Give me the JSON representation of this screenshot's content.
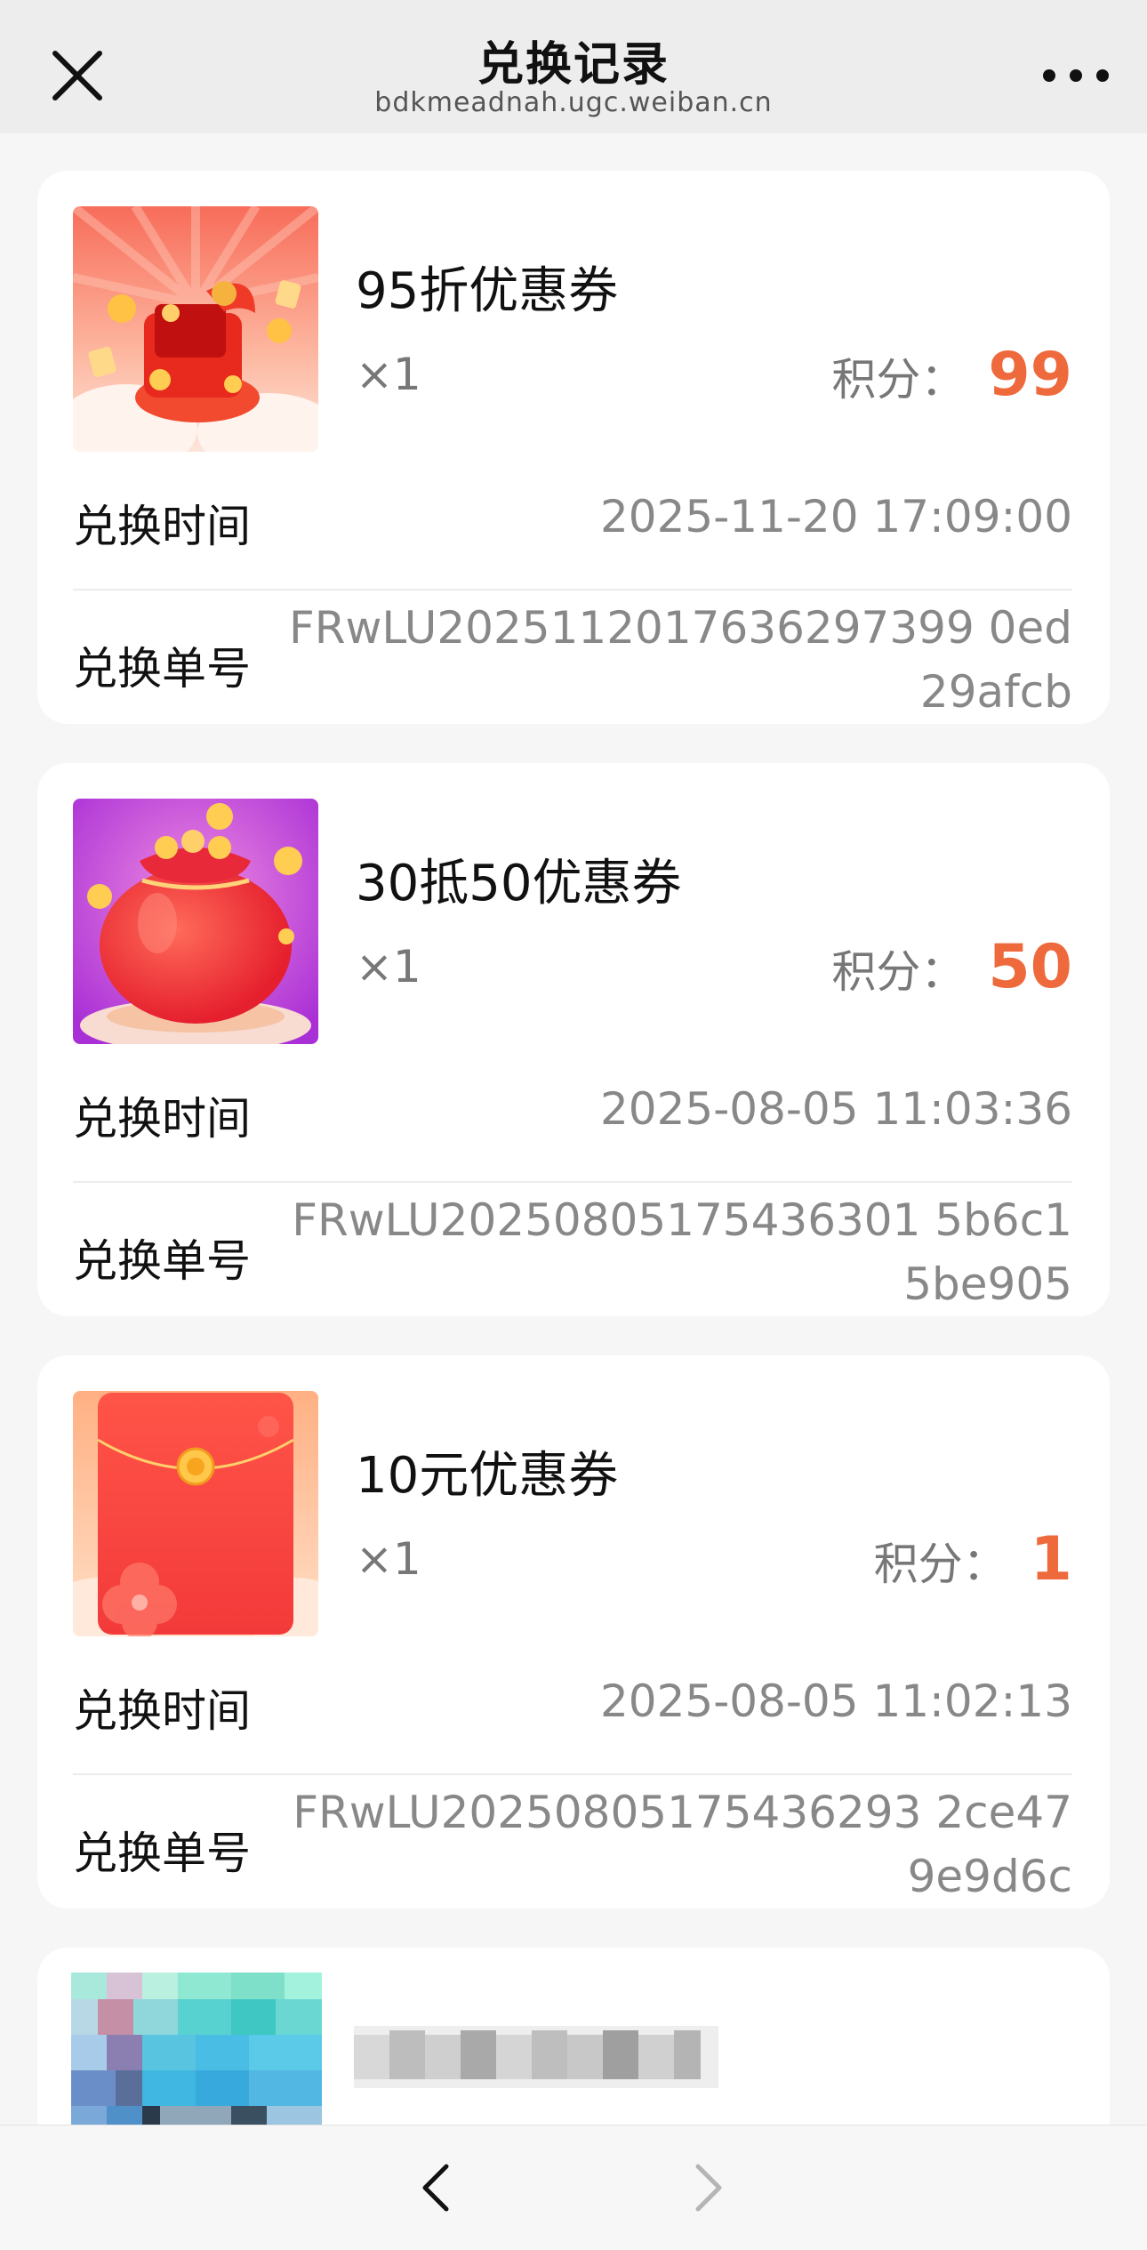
{
  "nav": {
    "title": "兑换记录",
    "url": "bdkmeadnah.ugc.weiban.cn",
    "close_icon": "close-icon",
    "more_icon": "more-dots-icon"
  },
  "accent_color": "#ee6a3c",
  "records": [
    {
      "name": "95折优惠券",
      "qty": "×1",
      "points_label": "积分：",
      "points": "99",
      "time_label": "兑换时间",
      "time": "2025-11-20 17:09:00",
      "order_label": "兑换单号",
      "order_no": "FRwLU2025112017636297399 0ed29afcb",
      "image": "gift-box-coins-image"
    },
    {
      "name": "30抵50优惠券",
      "qty": "×1",
      "points_label": "积分：",
      "points": "50",
      "time_label": "兑换时间",
      "time": "2025-08-05 11:03:36",
      "order_label": "兑换单号",
      "order_no": "FRwLU20250805175436301 5b6c15be905",
      "image": "money-bag-image"
    },
    {
      "name": "10元优惠券",
      "qty": "×1",
      "points_label": "积分：",
      "points": "1",
      "time_label": "兑换时间",
      "time": "2025-08-05 11:02:13",
      "order_label": "兑换单号",
      "order_no": "FRwLU20250805175436293 2ce479e9d6c",
      "image": "red-envelope-image"
    }
  ],
  "footer": {
    "back_icon": "chevron-left-icon",
    "forward_icon": "chevron-right-icon"
  }
}
